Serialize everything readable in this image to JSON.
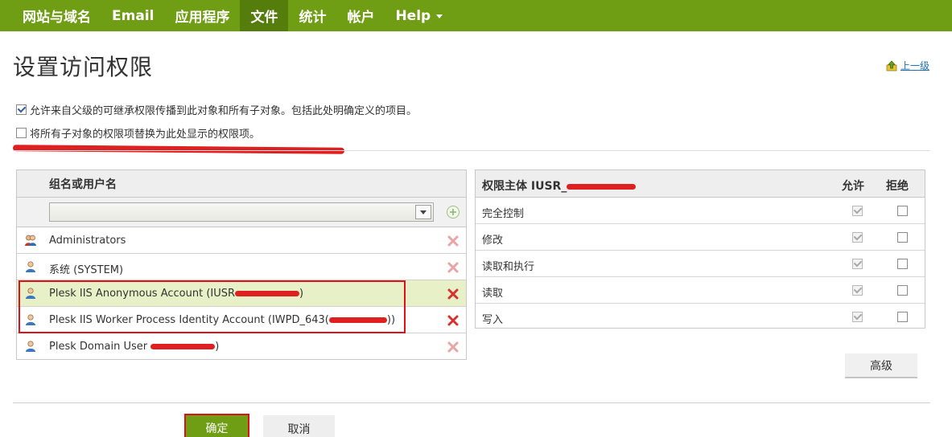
{
  "nav": {
    "items": [
      {
        "label": "网站与域名"
      },
      {
        "label": "Email"
      },
      {
        "label": "应用程序"
      },
      {
        "label": "文件",
        "active": true
      },
      {
        "label": "统计"
      },
      {
        "label": "帐户"
      },
      {
        "label": "Help"
      }
    ]
  },
  "page": {
    "title": "设置访问权限",
    "up_link": "上一级"
  },
  "options": {
    "inherit_label": "允许来自父级的可继承权限传播到此对象和所有子对象。包括此处明确定义的项目。",
    "inherit_checked": true,
    "replace_label": "将所有子对象的权限项替换为此处显示的权限项。",
    "replace_checked": false
  },
  "users_table": {
    "header": "组名或用户名",
    "search_value": "",
    "rows": [
      {
        "name": "Administrators",
        "icon": "group-icon"
      },
      {
        "name": "系统 (SYSTEM)",
        "icon": "user-icon"
      },
      {
        "name_prefix": "Plesk IIS Anonymous Account (IUSR",
        "name_suffix": ")",
        "icon": "user-icon",
        "selected": true
      },
      {
        "name_prefix": "Plesk IIS Worker Process Identity Account (IWPD_643(",
        "name_suffix": "))",
        "icon": "user-icon"
      },
      {
        "name_prefix": "Plesk Domain User ",
        "name_suffix": ")",
        "icon": "user-icon"
      }
    ]
  },
  "permissions_table": {
    "header_prefix": "权限主体 IUSR_",
    "allow_header": "允许",
    "deny_header": "拒绝",
    "rows": [
      {
        "label": "完全控制",
        "allow": true,
        "deny": false
      },
      {
        "label": "修改",
        "allow": true,
        "deny": false
      },
      {
        "label": "读取和执行",
        "allow": true,
        "deny": false
      },
      {
        "label": "读取",
        "allow": true,
        "deny": false
      },
      {
        "label": "写入",
        "allow": true,
        "deny": false
      }
    ]
  },
  "buttons": {
    "advanced": "高级",
    "ok": "确定",
    "cancel": "取消"
  },
  "colors": {
    "nav_bg": "#6f9e15",
    "nav_active": "#547d0c",
    "highlight_row": "#e7f0c6",
    "annotation_red": "#e0101a"
  }
}
